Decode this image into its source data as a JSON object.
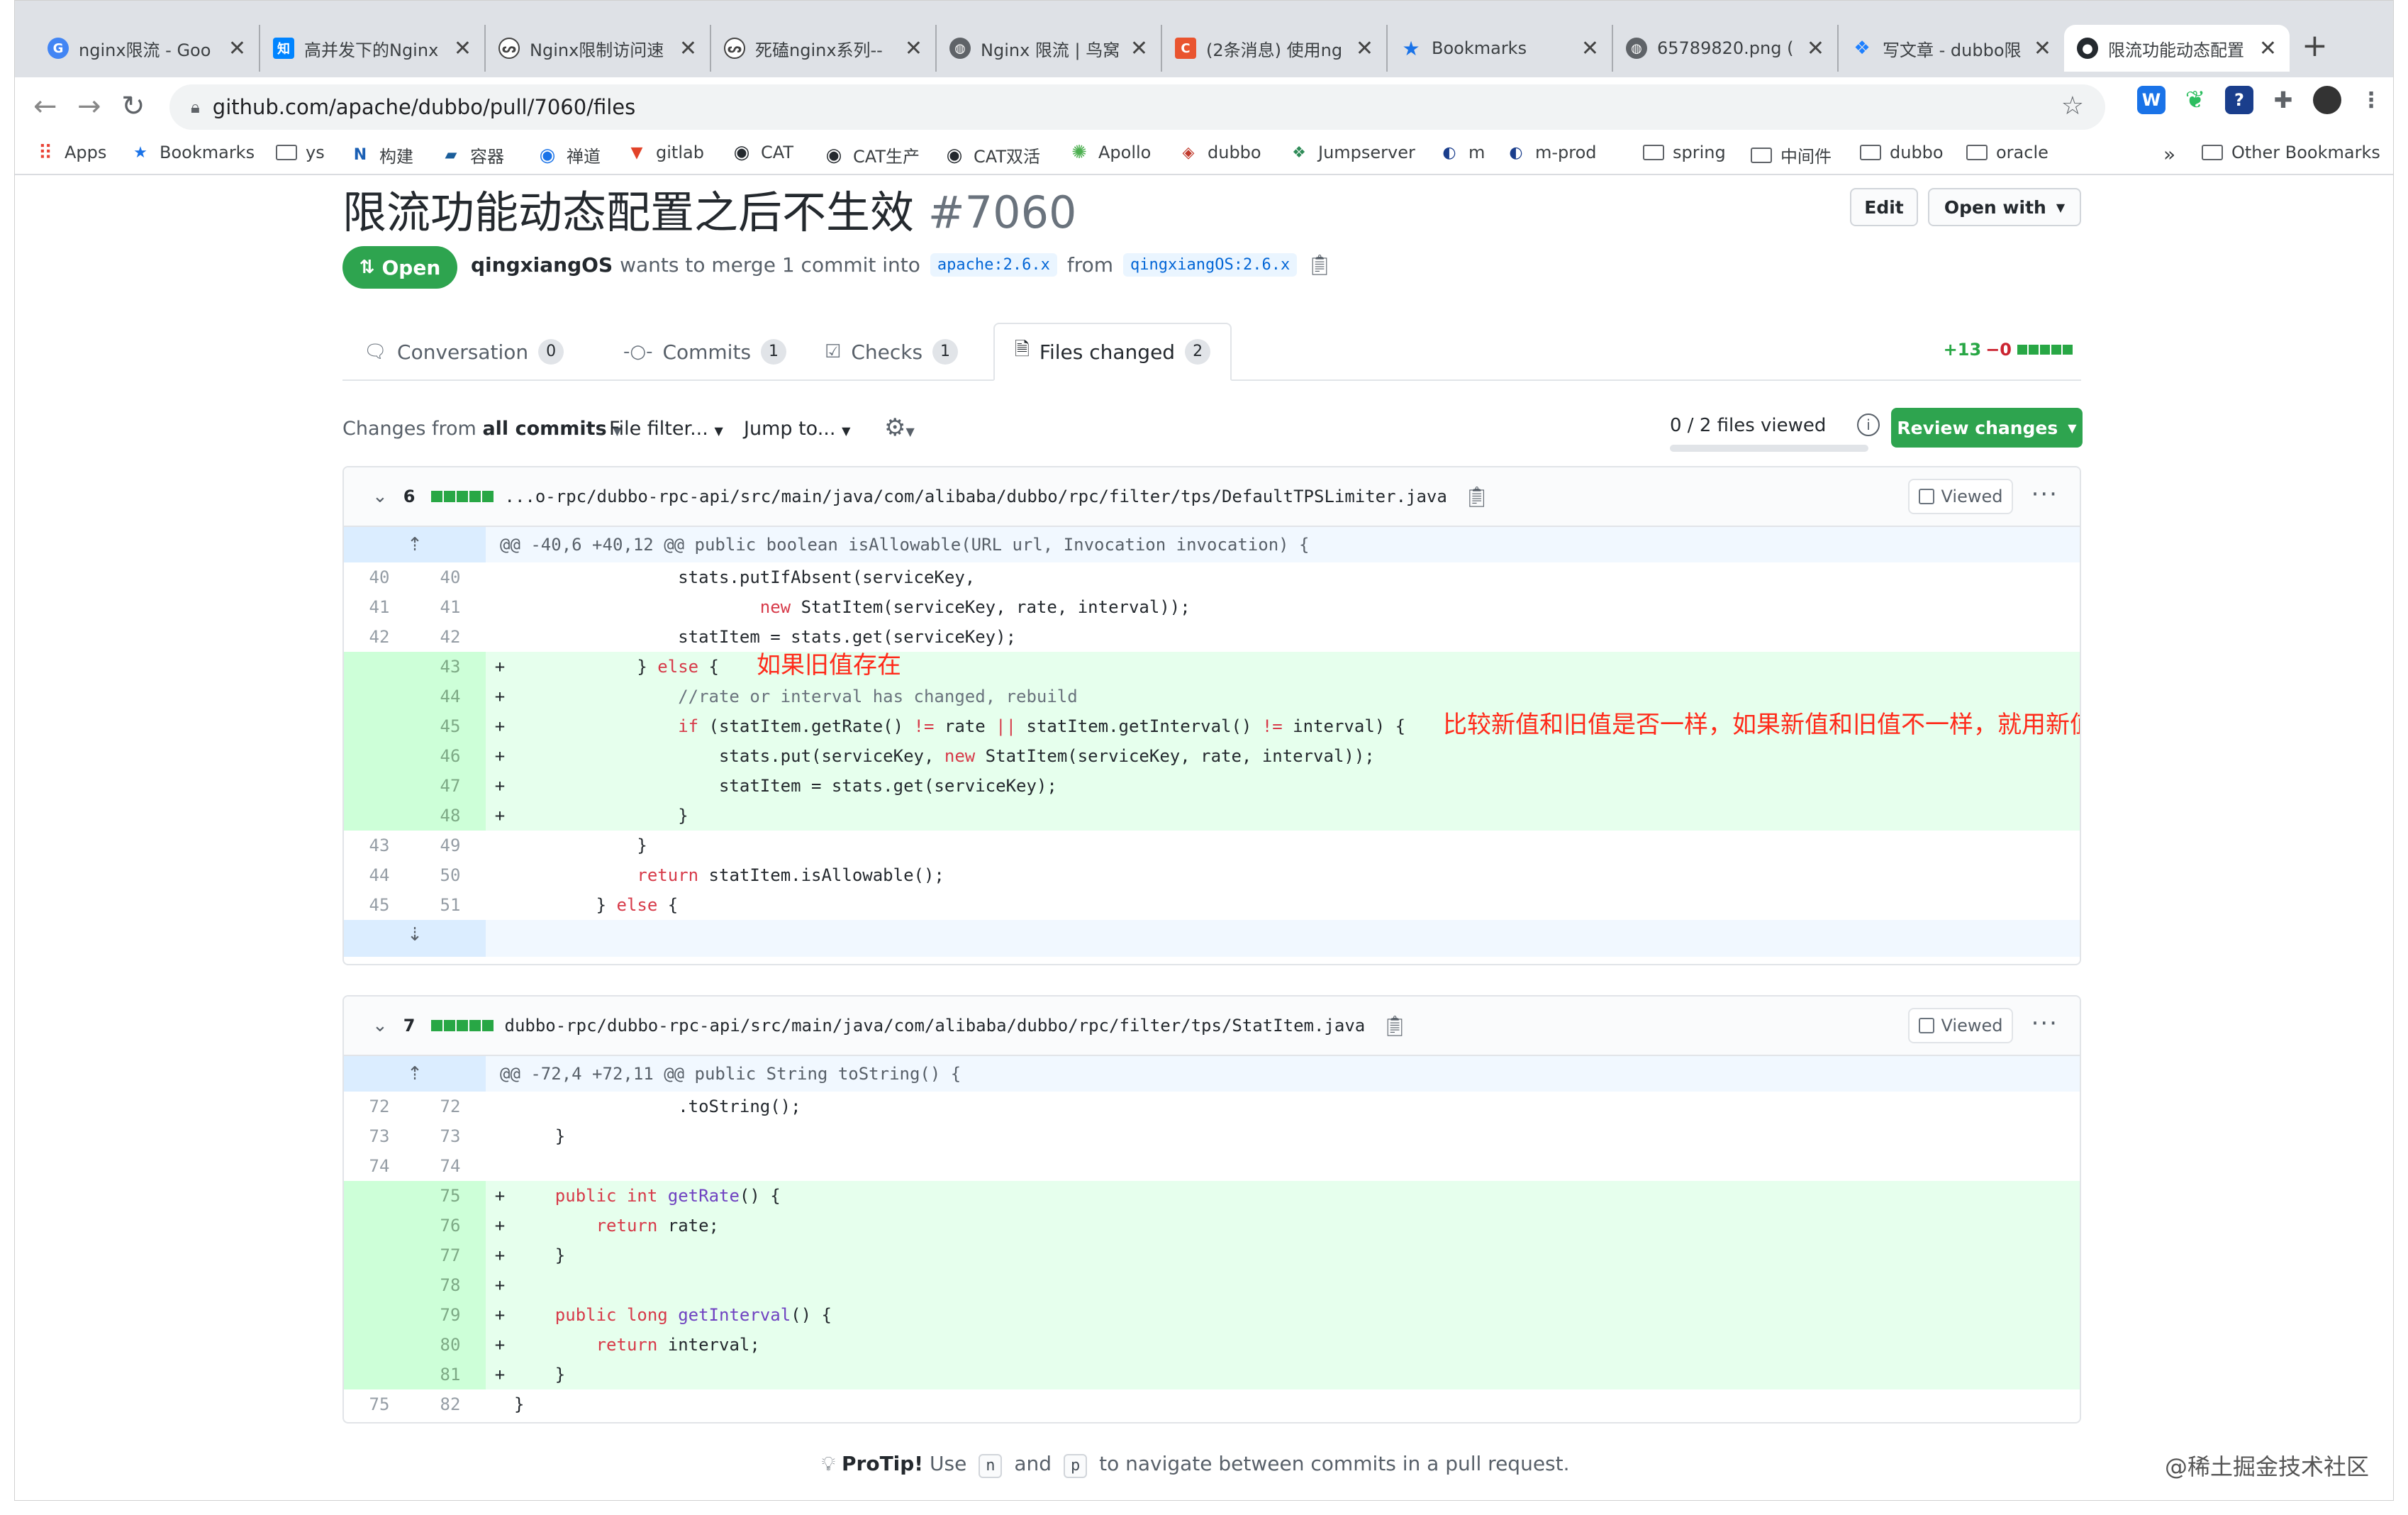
{
  "browser": {
    "tabs": [
      {
        "title": "nginx限流 - Goo",
        "icon": "google-icon",
        "color": "#4285f4",
        "glyph": "G"
      },
      {
        "title": "高并发下的Nginx",
        "icon": "zhihu-icon",
        "color": "#0084ff",
        "glyph": "知"
      },
      {
        "title": "Nginx限制访问速",
        "icon": "yuque-icon",
        "color": "#555",
        "glyph": "ᔕ"
      },
      {
        "title": "死磕nginx系列--",
        "icon": "yuque-icon",
        "color": "#555",
        "glyph": "ᔕ"
      },
      {
        "title": "Nginx 限流 | 鸟窝",
        "icon": "globe-icon",
        "color": "#5f6368",
        "glyph": "◍"
      },
      {
        "title": "(2条消息) 使用ng",
        "icon": "csdn-icon",
        "color": "#e9542f",
        "glyph": "C"
      },
      {
        "title": "Bookmarks",
        "icon": "star-icon",
        "color": "#1a73e8",
        "glyph": "★"
      },
      {
        "title": "65789820.png (",
        "icon": "globe-icon",
        "color": "#5f6368",
        "glyph": "◍"
      },
      {
        "title": "写文章 - dubbo限",
        "icon": "juejin-icon",
        "color": "#1e80ff",
        "glyph": "❖"
      },
      {
        "title": "限流功能动态配置",
        "icon": "github-icon",
        "color": "#24292e",
        "glyph": "●"
      }
    ],
    "url": "github.com/apache/dubbo/pull/7060/files",
    "bookmarks": [
      {
        "label": "Apps",
        "icon": "apps-grid-icon"
      },
      {
        "label": "Bookmarks",
        "icon": "star-icon"
      },
      {
        "label": "ys",
        "icon": "folder-icon"
      },
      {
        "label": "构建",
        "icon": "nexus-icon"
      },
      {
        "label": "容器",
        "icon": "rancher-icon"
      },
      {
        "label": "禅道",
        "icon": "zentao-icon"
      },
      {
        "label": "gitlab",
        "icon": "gitlab-icon"
      },
      {
        "label": "CAT",
        "icon": "github-icon"
      },
      {
        "label": "CAT生产",
        "icon": "github-icon"
      },
      {
        "label": "CAT双活",
        "icon": "github-icon"
      },
      {
        "label": "Apollo",
        "icon": "apollo-icon"
      },
      {
        "label": "dubbo",
        "icon": "dubbo-icon"
      },
      {
        "label": "Jumpserver",
        "icon": "jumpserver-icon"
      },
      {
        "label": "m",
        "icon": "spring-icon"
      },
      {
        "label": "m-prod",
        "icon": "spring-icon"
      },
      {
        "label": "spring",
        "icon": "folder-icon"
      },
      {
        "label": "中间件",
        "icon": "folder-icon"
      },
      {
        "label": "dubbo",
        "icon": "folder-icon"
      },
      {
        "label": "oracle",
        "icon": "folder-icon"
      }
    ],
    "more_bookmarks": "»",
    "other_bookmarks": "Other Bookmarks"
  },
  "pr": {
    "title": "限流功能动态配置之后不生效",
    "number": "#7060",
    "edit_label": "Edit",
    "open_with_label": "Open with",
    "state": "Open",
    "author": "qingxiangOS",
    "merge_text": "wants to merge 1 commit into",
    "base_branch": "apache:2.6.x",
    "from_text": "from",
    "head_branch": "qingxiangOS:2.6.x",
    "tabs": [
      {
        "label": "Conversation",
        "count": "0",
        "icon": "comment-icon"
      },
      {
        "label": "Commits",
        "count": "1",
        "icon": "commit-icon"
      },
      {
        "label": "Checks",
        "count": "1",
        "icon": "checklist-icon"
      },
      {
        "label": "Files changed",
        "count": "2",
        "icon": "file-diff-icon"
      }
    ],
    "diffstat": {
      "additions": "+13",
      "deletions": "−0"
    },
    "filter": {
      "changes_prefix": "Changes from",
      "changes_value": "all commits",
      "file_filter": "File filter...",
      "jump_to": "Jump to...",
      "files_viewed": "0 / 2 files viewed",
      "files_viewed_fraction": 0,
      "review_changes": "Review changes"
    }
  },
  "files": [
    {
      "count": "6",
      "path": "...o-rpc/dubbo-rpc-api/src/main/java/com/alibaba/dubbo/rpc/filter/tps/DefaultTPSLimiter.java",
      "viewed_label": "Viewed",
      "hunk": "@@ -40,6 +40,12 @@ public boolean isAllowable(URL url, Invocation invocation) {",
      "lines": [
        {
          "old": "40",
          "new": "40",
          "type": "ctx",
          "code": "                stats.putIfAbsent(serviceKey,"
        },
        {
          "old": "41",
          "new": "41",
          "type": "ctx",
          "code": "                        new StatItem(serviceKey, rate, interval));"
        },
        {
          "old": "42",
          "new": "42",
          "type": "ctx",
          "code": "                statItem = stats.get(serviceKey);"
        },
        {
          "old": "",
          "new": "43",
          "type": "add",
          "code": "            } else {"
        },
        {
          "old": "",
          "new": "44",
          "type": "add",
          "code": "                //rate or interval has changed, rebuild"
        },
        {
          "old": "",
          "new": "45",
          "type": "add",
          "code": "                if (statItem.getRate() != rate || statItem.getInterval() != interval) {"
        },
        {
          "old": "",
          "new": "46",
          "type": "add",
          "code": "                    stats.put(serviceKey, new StatItem(serviceKey, rate, interval));"
        },
        {
          "old": "",
          "new": "47",
          "type": "add",
          "code": "                    statItem = stats.get(serviceKey);"
        },
        {
          "old": "",
          "new": "48",
          "type": "add",
          "code": "                }"
        },
        {
          "old": "43",
          "new": "49",
          "type": "ctx",
          "code": "            }"
        },
        {
          "old": "44",
          "new": "50",
          "type": "ctx",
          "code": "            return statItem.isAllowable();"
        },
        {
          "old": "45",
          "new": "51",
          "type": "ctx",
          "code": "        } else {"
        }
      ]
    },
    {
      "count": "7",
      "path": "dubbo-rpc/dubbo-rpc-api/src/main/java/com/alibaba/dubbo/rpc/filter/tps/StatItem.java",
      "viewed_label": "Viewed",
      "hunk": "@@ -72,4 +72,11 @@ public String toString() {",
      "lines": [
        {
          "old": "72",
          "new": "72",
          "type": "ctx",
          "code": "                .toString();"
        },
        {
          "old": "73",
          "new": "73",
          "type": "ctx",
          "code": "    }"
        },
        {
          "old": "74",
          "new": "74",
          "type": "ctx",
          "code": ""
        },
        {
          "old": "",
          "new": "75",
          "type": "add",
          "code": "    public int getRate() {"
        },
        {
          "old": "",
          "new": "76",
          "type": "add",
          "code": "        return rate;"
        },
        {
          "old": "",
          "new": "77",
          "type": "add",
          "code": "    }"
        },
        {
          "old": "",
          "new": "78",
          "type": "add",
          "code": ""
        },
        {
          "old": "",
          "new": "79",
          "type": "add",
          "code": "    public long getInterval() {"
        },
        {
          "old": "",
          "new": "80",
          "type": "add",
          "code": "        return interval;"
        },
        {
          "old": "",
          "new": "81",
          "type": "add",
          "code": "    }"
        },
        {
          "old": "75",
          "new": "82",
          "type": "ctx",
          "code": "}"
        }
      ]
    }
  ],
  "annotations": {
    "note_1": "如果旧值存在",
    "note_2": "比较新值和旧值是否一样，如果新值和旧值不一样，就用新值"
  },
  "protip": {
    "label": "ProTip!",
    "use": "Use",
    "key_n": "n",
    "and": "and",
    "key_p": "p",
    "rest": "to navigate between commits in a pull request."
  },
  "watermark": "@稀土掘金技术社区",
  "colors": {
    "accent_green": "#2ea44f",
    "link_blue": "#0366d6",
    "annotation_red": "#ff2a1a"
  }
}
